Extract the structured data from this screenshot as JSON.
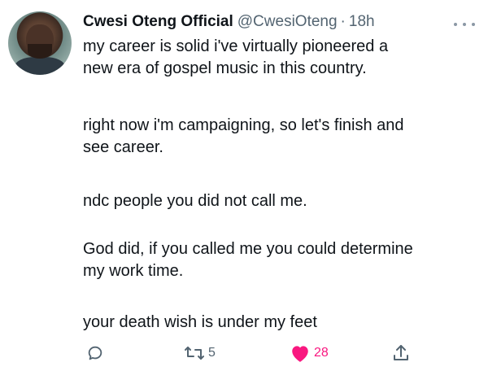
{
  "author": {
    "display_name": "Cwesi Oteng Official",
    "handle": "@CwesiOteng",
    "separator": "·",
    "time": "18h"
  },
  "tweet": {
    "paragraphs": [
      "my career is solid i've virtually pioneered a\nnew era of gospel music in this country.",
      "right now i'm campaigning, so let's finish and\nsee career.",
      "ndc people you did not call me.",
      "God did, if you called me you could determine\nmy work time.",
      "your death wish is under my feet"
    ]
  },
  "actions": {
    "reply_icon": "reply-icon",
    "retweet_icon": "retweet-icon",
    "retweet_count": "5",
    "like_icon": "heart-icon",
    "like_count": "28",
    "like_color": "#f91880",
    "share_icon": "share-icon"
  },
  "more_icon": "more-icon"
}
